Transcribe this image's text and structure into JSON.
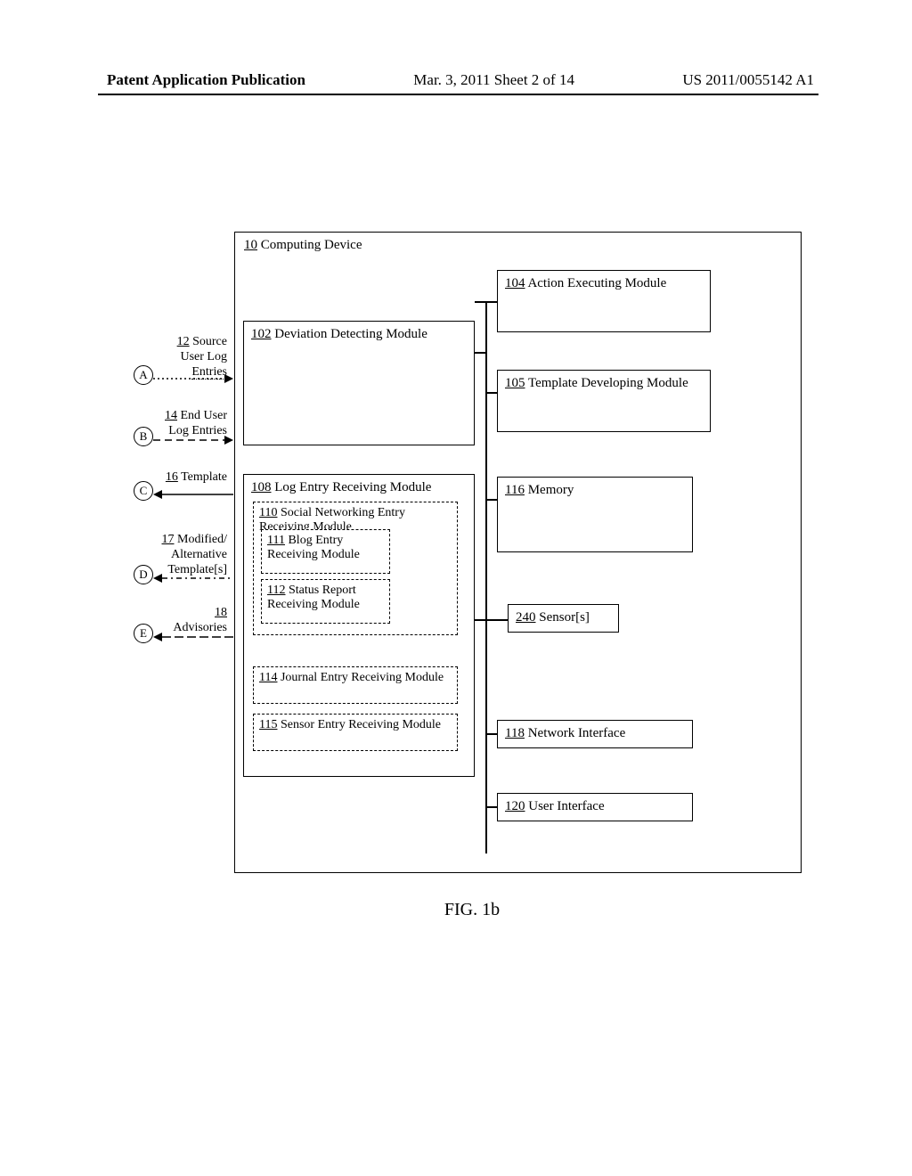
{
  "header": {
    "left": "Patent Application Publication",
    "center": "Mar. 3, 2011  Sheet 2 of 14",
    "right": "US 2011/0055142 A1"
  },
  "main_box": {
    "num": "10",
    "title": "Computing Device"
  },
  "modules": {
    "dev_detect": {
      "num": "102",
      "title": "Deviation Detecting Module"
    },
    "action_exec": {
      "num": "104",
      "title": "Action Executing Module"
    },
    "template_dev": {
      "num": "105",
      "title": "Template Developing Module"
    },
    "log_entry": {
      "num": "108",
      "title": "Log Entry Receiving Module"
    },
    "social_net": {
      "num": "110",
      "title": "Social Networking Entry Receiving Module"
    },
    "blog_entry": {
      "num": "111",
      "title": "Blog Entry Receiving Module"
    },
    "status_report": {
      "num": "112",
      "title": "Status Report Receiving Module"
    },
    "journal_entry": {
      "num": "114",
      "title": "Journal Entry Receiving Module"
    },
    "sensor_entry": {
      "num": "115",
      "title": "Sensor Entry Receiving Module"
    },
    "memory": {
      "num": "116",
      "title": "Memory"
    },
    "sensors": {
      "num": "240",
      "title": "Sensor[s]"
    },
    "net_interface": {
      "num": "118",
      "title": "Network Interface"
    },
    "user_interface": {
      "num": "120",
      "title": "User Interface"
    }
  },
  "externals": {
    "a": {
      "num": "12",
      "line1": "Source",
      "line2": "User Log",
      "line3": "Entries",
      "circle": "A"
    },
    "b": {
      "num": "14",
      "line1": "End User",
      "line2": "Log Entries",
      "circle": "B"
    },
    "c": {
      "num": "16",
      "line1": "Template",
      "circle": "C"
    },
    "d": {
      "num": "17",
      "line1": "Modified/",
      "line2": "Alternative",
      "line3": "Template[s]",
      "circle": "D"
    },
    "e": {
      "num": "18",
      "line1": "Advisories",
      "circle": "E"
    }
  },
  "figure": "FIG. 1b"
}
